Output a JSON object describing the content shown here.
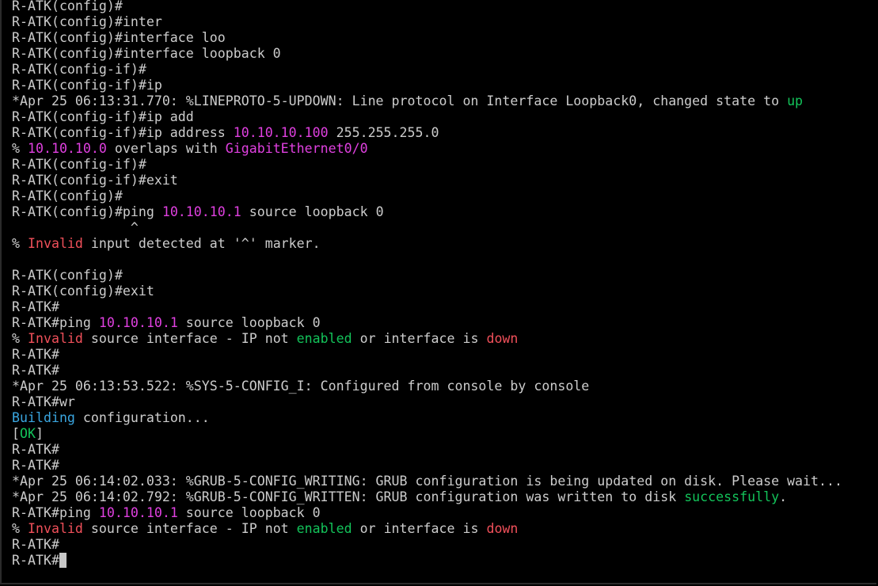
{
  "terminal": {
    "lines": [
      [
        {
          "t": "R-ATK(config)#",
          "c": "plain"
        }
      ],
      [
        {
          "t": "R-ATK(config)#inter",
          "c": "plain"
        }
      ],
      [
        {
          "t": "R-ATK(config)#interface loo",
          "c": "plain"
        }
      ],
      [
        {
          "t": "R-ATK(config)#interface loopback 0",
          "c": "plain"
        }
      ],
      [
        {
          "t": "R-ATK(config-if)#",
          "c": "plain"
        }
      ],
      [
        {
          "t": "R-ATK(config-if)#ip",
          "c": "plain"
        }
      ],
      [
        {
          "t": "*Apr 25 06:13:31.770: %LINEPROTO-5-UPDOWN: Line protocol on Interface Loopback0, changed state to ",
          "c": "plain"
        },
        {
          "t": "up",
          "c": "green"
        }
      ],
      [
        {
          "t": "R-ATK(config-if)#ip add",
          "c": "plain"
        }
      ],
      [
        {
          "t": "R-ATK(config-if)#ip address ",
          "c": "plain"
        },
        {
          "t": "10.10.10.100",
          "c": "ip"
        },
        {
          "t": " 255.255.255.0",
          "c": "plain"
        }
      ],
      [
        {
          "t": "% ",
          "c": "plain"
        },
        {
          "t": "10.10.10.0",
          "c": "ip"
        },
        {
          "t": " overlaps with ",
          "c": "plain"
        },
        {
          "t": "GigabitEthernet0/0",
          "c": "ip"
        }
      ],
      [
        {
          "t": "R-ATK(config-if)#",
          "c": "plain"
        }
      ],
      [
        {
          "t": "R-ATK(config-if)#exit",
          "c": "plain"
        }
      ],
      [
        {
          "t": "R-ATK(config)#",
          "c": "plain"
        }
      ],
      [
        {
          "t": "R-ATK(config)#ping ",
          "c": "plain"
        },
        {
          "t": "10.10.10.1",
          "c": "ip"
        },
        {
          "t": " source loopback 0",
          "c": "plain"
        }
      ],
      [
        {
          "t": "               ^",
          "c": "plain"
        }
      ],
      [
        {
          "t": "% ",
          "c": "plain"
        },
        {
          "t": "Invalid",
          "c": "red"
        },
        {
          "t": " input detected at '^' marker.",
          "c": "plain"
        }
      ],
      [
        {
          "t": "",
          "c": "plain"
        }
      ],
      [
        {
          "t": "R-ATK(config)#",
          "c": "plain"
        }
      ],
      [
        {
          "t": "R-ATK(config)#exit",
          "c": "plain"
        }
      ],
      [
        {
          "t": "R-ATK#",
          "c": "plain"
        }
      ],
      [
        {
          "t": "R-ATK#ping ",
          "c": "plain"
        },
        {
          "t": "10.10.10.1",
          "c": "ip"
        },
        {
          "t": " source loopback 0",
          "c": "plain"
        }
      ],
      [
        {
          "t": "% ",
          "c": "plain"
        },
        {
          "t": "Invalid",
          "c": "red"
        },
        {
          "t": " source interface - IP not ",
          "c": "plain"
        },
        {
          "t": "enabled",
          "c": "green"
        },
        {
          "t": " or interface is ",
          "c": "plain"
        },
        {
          "t": "down",
          "c": "red"
        }
      ],
      [
        {
          "t": "R-ATK#",
          "c": "plain"
        }
      ],
      [
        {
          "t": "R-ATK#",
          "c": "plain"
        }
      ],
      [
        {
          "t": "*Apr 25 06:13:53.522: %SYS-5-CONFIG_I: Configured from console by console",
          "c": "plain"
        }
      ],
      [
        {
          "t": "R-ATK#wr",
          "c": "plain"
        }
      ],
      [
        {
          "t": "Building",
          "c": "blue"
        },
        {
          "t": " configuration...",
          "c": "plain"
        }
      ],
      [
        {
          "t": "[",
          "c": "plain"
        },
        {
          "t": "OK",
          "c": "green"
        },
        {
          "t": "]",
          "c": "plain"
        }
      ],
      [
        {
          "t": "R-ATK#",
          "c": "plain"
        }
      ],
      [
        {
          "t": "R-ATK#",
          "c": "plain"
        }
      ],
      [
        {
          "t": "*Apr 25 06:14:02.033: %GRUB-5-CONFIG_WRITING: GRUB configuration is being updated on disk. Please wait...",
          "c": "plain"
        }
      ],
      [
        {
          "t": "*Apr 25 06:14:02.792: %GRUB-5-CONFIG_WRITTEN: GRUB configuration was written to disk ",
          "c": "plain"
        },
        {
          "t": "successfully",
          "c": "green"
        },
        {
          "t": ".",
          "c": "plain"
        }
      ],
      [
        {
          "t": "R-ATK#ping ",
          "c": "plain"
        },
        {
          "t": "10.10.10.1",
          "c": "ip"
        },
        {
          "t": " source loopback 0",
          "c": "plain"
        }
      ],
      [
        {
          "t": "% ",
          "c": "plain"
        },
        {
          "t": "Invalid",
          "c": "red"
        },
        {
          "t": " source interface - IP not ",
          "c": "plain"
        },
        {
          "t": "enabled",
          "c": "green"
        },
        {
          "t": " or interface is ",
          "c": "plain"
        },
        {
          "t": "down",
          "c": "red"
        }
      ],
      [
        {
          "t": "R-ATK#",
          "c": "plain"
        }
      ]
    ],
    "prompt": "R-ATK#",
    "colors": {
      "background": "#000000",
      "plain": "#cccccc",
      "ip": "#e040e0",
      "green": "#13c35a",
      "red": "#f0505a",
      "blue": "#3aa6e0",
      "cursor": "#c8c8c8"
    }
  }
}
